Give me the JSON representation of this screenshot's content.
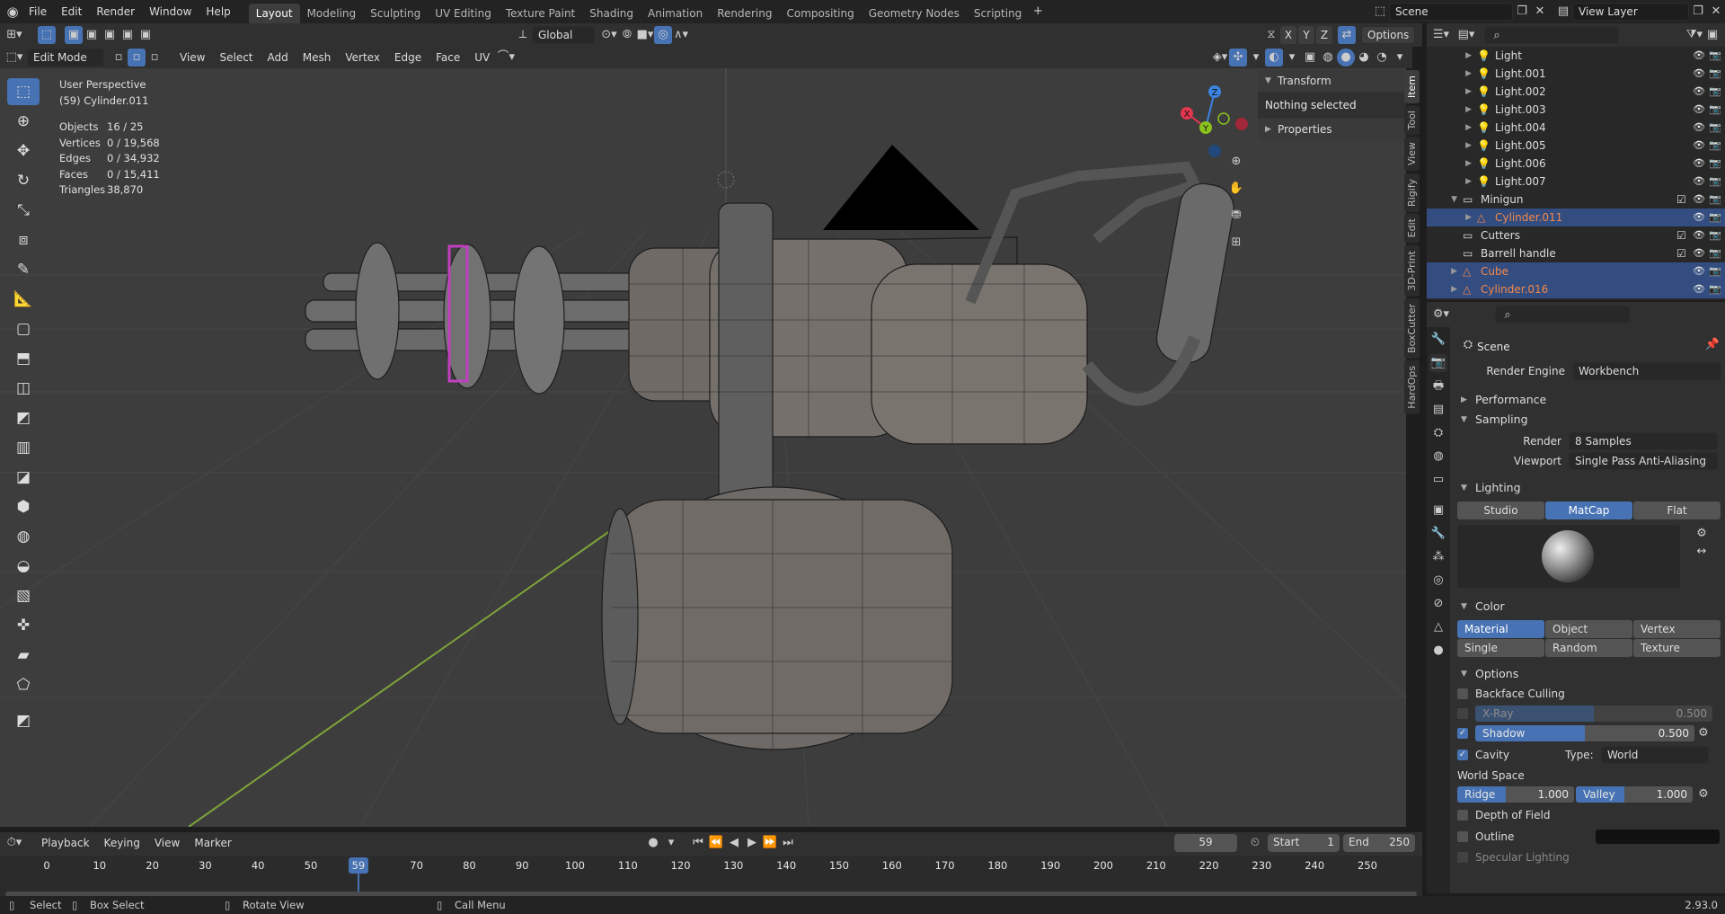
{
  "topbar": {
    "menus": [
      "File",
      "Edit",
      "Render",
      "Window",
      "Help"
    ],
    "workspaces": [
      "Layout",
      "Modeling",
      "Sculpting",
      "UV Editing",
      "Texture Paint",
      "Shading",
      "Animation",
      "Rendering",
      "Compositing",
      "Geometry Nodes",
      "Scripting"
    ],
    "active_workspace": "Layout",
    "scene": "Scene",
    "view_layer": "View Layer"
  },
  "toolheader": {
    "orientation": "Global",
    "options": "Options",
    "axes": [
      "X",
      "Y",
      "Z"
    ]
  },
  "vpheader": {
    "mode": "Edit Mode",
    "menus": [
      "View",
      "Select",
      "Add",
      "Mesh",
      "Vertex",
      "Edge",
      "Face",
      "UV"
    ]
  },
  "viewport": {
    "title": "User Perspective",
    "object": "(59) Cylinder.011",
    "stats": [
      {
        "k": "Objects",
        "v": "16 / 25"
      },
      {
        "k": "Vertices",
        "v": "0 / 19,568"
      },
      {
        "k": "Edges",
        "v": "0 / 34,932"
      },
      {
        "k": "Faces",
        "v": "0 / 15,411"
      },
      {
        "k": "Triangles",
        "v": "38,870"
      }
    ]
  },
  "npanel": {
    "transform": "Transform",
    "nothing": "Nothing selected",
    "properties": "Properties",
    "tabs": [
      "Item",
      "Tool",
      "View",
      "Rigify",
      "Edit",
      "3D-Print",
      "BoxCutter",
      "HardOps"
    ]
  },
  "gizmo": {
    "x": "X",
    "y": "Y",
    "z": "Z",
    "colors": {
      "x": "#e3364f",
      "y": "#8ac21d",
      "z": "#3b84e0"
    }
  },
  "outliner": {
    "rows": [
      {
        "name": "Light",
        "indent": 2,
        "type": "light",
        "sel": false
      },
      {
        "name": "Light.001",
        "indent": 2,
        "type": "light",
        "sel": false
      },
      {
        "name": "Light.002",
        "indent": 2,
        "type": "light",
        "sel": false
      },
      {
        "name": "Light.003",
        "indent": 2,
        "type": "light",
        "sel": false
      },
      {
        "name": "Light.004",
        "indent": 2,
        "type": "light",
        "sel": false
      },
      {
        "name": "Light.005",
        "indent": 2,
        "type": "light",
        "sel": false
      },
      {
        "name": "Light.006",
        "indent": 2,
        "type": "light",
        "sel": false
      },
      {
        "name": "Light.007",
        "indent": 2,
        "type": "light",
        "sel": false
      },
      {
        "name": "Minigun",
        "indent": 1,
        "type": "coll",
        "sel": false
      },
      {
        "name": "Cylinder.011",
        "indent": 2,
        "type": "mesh",
        "sel": true
      },
      {
        "name": "Cutters",
        "indent": 1,
        "type": "coll",
        "sel": false
      },
      {
        "name": "Barrell handle",
        "indent": 1,
        "type": "coll",
        "sel": false
      },
      {
        "name": "Cube",
        "indent": 1,
        "type": "mesh",
        "sel": true
      },
      {
        "name": "Cylinder.016",
        "indent": 1,
        "type": "mesh",
        "sel": true
      }
    ]
  },
  "props": {
    "scene": "Scene",
    "render_engine_label": "Render Engine",
    "render_engine": "Workbench",
    "performance": "Performance",
    "sampling": "Sampling",
    "render_label": "Render",
    "render_samples": "8 Samples",
    "viewport_label": "Viewport",
    "viewport_aa": "Single Pass Anti-Aliasing",
    "lighting": "Lighting",
    "lighting_opts": [
      "Studio",
      "MatCap",
      "Flat"
    ],
    "lighting_active": "MatCap",
    "color": "Color",
    "color_opts": [
      "Material",
      "Object",
      "Vertex",
      "Single",
      "Random",
      "Texture"
    ],
    "color_active": "Material",
    "options": "Options",
    "backface": "Backface Culling",
    "xray": "X-Ray",
    "xray_val": "0.500",
    "xray_fill": 0.5,
    "shadow": "Shadow",
    "shadow_val": "0.500",
    "shadow_fill": 0.5,
    "cavity": "Cavity",
    "type_label": "Type:",
    "type_val": "World",
    "world_space": "World Space",
    "ridge": "Ridge",
    "ridge_val": "1.000",
    "valley": "Valley",
    "valley_val": "1.000",
    "dof": "Depth of Field",
    "outline": "Outline",
    "specular": "Specular Lighting"
  },
  "timeline": {
    "menus": [
      "Playback",
      "Keying",
      "View",
      "Marker"
    ],
    "frame": "59",
    "start_label": "Start",
    "start": "1",
    "end_label": "End",
    "end": "250",
    "ticks": [
      0,
      10,
      20,
      30,
      40,
      50,
      59,
      70,
      80,
      90,
      100,
      110,
      120,
      130,
      140,
      150,
      160,
      170,
      180,
      190,
      200,
      210,
      220,
      230,
      240,
      250
    ],
    "current": 59
  },
  "status": {
    "select": "Select",
    "box": "Box Select",
    "rotate": "Rotate View",
    "menu": "Call Menu",
    "version": "2.93.0"
  },
  "colors": {
    "accent": "#4772b3",
    "selected_obj": "#f2884a",
    "grid_green": "#7fa33a"
  }
}
